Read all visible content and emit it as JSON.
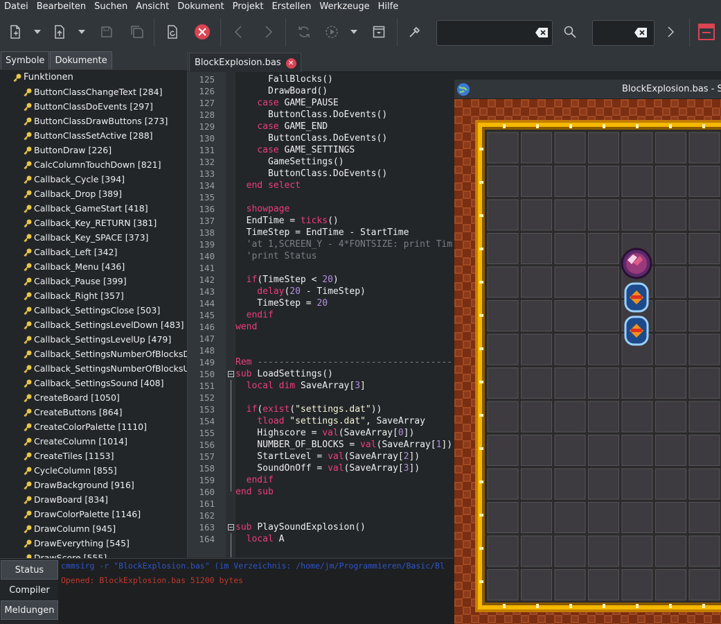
{
  "menu": [
    "Datei",
    "Bearbeiten",
    "Suchen",
    "Ansicht",
    "Dokument",
    "Projekt",
    "Erstellen",
    "Werkzeuge",
    "Hilfe"
  ],
  "toolbar": {
    "icons": [
      "new-file-icon",
      "open-file-icon",
      "save-icon",
      "save-all-icon",
      "reload-file-icon",
      "close-file-icon",
      "back-icon",
      "forward-icon",
      "compile-icon",
      "run-icon",
      "execute-icon",
      "color-chooser-icon",
      "search-icon",
      "jump-icon",
      "quit-icon"
    ],
    "search_value": "",
    "goto_value": ""
  },
  "left_panel": {
    "tabs": [
      "Symbole",
      "Dokumente"
    ],
    "active_tab": "Dokumente",
    "tree_root": "Funktionen",
    "items": [
      "ButtonClassChangeText [284]",
      "ButtonClassDoEvents [297]",
      "ButtonClassDrawButtons [273]",
      "ButtonClassSetActive [288]",
      "ButtonDraw [226]",
      "CalcColumnTouchDown [821]",
      "Callback_Cycle [394]",
      "Callback_Drop [389]",
      "Callback_GameStart [418]",
      "Callback_Key_RETURN [381]",
      "Callback_Key_SPACE [373]",
      "Callback_Left [342]",
      "Callback_Menu [436]",
      "Callback_Pause [399]",
      "Callback_Right [357]",
      "Callback_SettingsClose [503]",
      "Callback_SettingsLevelDown [483]",
      "Callback_SettingsLevelUp [479]",
      "Callback_SettingsNumberOfBlocksDo",
      "Callback_SettingsNumberOfBlocksUp",
      "Callback_SettingsSound [408]",
      "CreateBoard [1050]",
      "CreateButtons [864]",
      "CreateColorPalette [1110]",
      "CreateColumn [1014]",
      "CreateTiles [1153]",
      "CycleColumn [855]",
      "DrawBackground [916]",
      "DrawBoard [834]",
      "DrawColorPalette [1146]",
      "DrawColumn [945]",
      "DrawEverything [545]",
      "DrawScore [555]"
    ]
  },
  "editor": {
    "tab_label": "BlockExplosion.bas",
    "lines": [
      {
        "n": "125",
        "t": [
          [
            "pl",
            "      FallBlocks()"
          ]
        ]
      },
      {
        "n": "126",
        "t": [
          [
            "pl",
            "      DrawBoard()"
          ]
        ]
      },
      {
        "n": "127",
        "t": [
          [
            "kw",
            "    case "
          ],
          [
            "pl",
            "GAME_PAUSE"
          ]
        ]
      },
      {
        "n": "128",
        "t": [
          [
            "pl",
            "      ButtonClass.DoEvents()"
          ]
        ]
      },
      {
        "n": "129",
        "t": [
          [
            "kw",
            "    case "
          ],
          [
            "pl",
            "GAME_END"
          ]
        ]
      },
      {
        "n": "130",
        "t": [
          [
            "pl",
            "      ButtonClass.DoEvents()"
          ]
        ]
      },
      {
        "n": "131",
        "t": [
          [
            "kw",
            "    case "
          ],
          [
            "pl",
            "GAME_SETTINGS"
          ]
        ]
      },
      {
        "n": "132",
        "t": [
          [
            "pl",
            "      GameSettings()"
          ]
        ]
      },
      {
        "n": "133",
        "t": [
          [
            "pl",
            "      ButtonClass.DoEvents()"
          ]
        ]
      },
      {
        "n": "134",
        "t": [
          [
            "kw",
            "  end select"
          ]
        ]
      },
      {
        "n": "135",
        "t": []
      },
      {
        "n": "136",
        "t": [
          [
            "kw",
            "  showpage"
          ]
        ]
      },
      {
        "n": "137",
        "t": [
          [
            "pl",
            "  EndTime = "
          ],
          [
            "kw",
            "ticks"
          ],
          [
            "pl",
            "()"
          ]
        ]
      },
      {
        "n": "138",
        "t": [
          [
            "pl",
            "  TimeStep = EndTime - StartTime"
          ]
        ]
      },
      {
        "n": "139",
        "t": [
          [
            "cmt",
            "  'at 1,SCREEN_Y - 4*FONTSIZE: print Tim"
          ]
        ]
      },
      {
        "n": "140",
        "t": [
          [
            "cmt",
            "  'print Status"
          ]
        ]
      },
      {
        "n": "141",
        "t": []
      },
      {
        "n": "142",
        "t": [
          [
            "kw",
            "  if"
          ],
          [
            "pl",
            "(TimeStep < "
          ],
          [
            "num",
            "20"
          ],
          [
            "pl",
            ")"
          ]
        ]
      },
      {
        "n": "143",
        "t": [
          [
            "kw",
            "    delay"
          ],
          [
            "pl",
            "("
          ],
          [
            "num",
            "20"
          ],
          [
            "pl",
            " - TimeStep)"
          ]
        ]
      },
      {
        "n": "144",
        "t": [
          [
            "pl",
            "    TimeStep = "
          ],
          [
            "num",
            "20"
          ]
        ]
      },
      {
        "n": "145",
        "t": [
          [
            "kw",
            "  endif"
          ]
        ]
      },
      {
        "n": "146",
        "t": [
          [
            "kw",
            "wend"
          ]
        ]
      },
      {
        "n": "147",
        "t": []
      },
      {
        "n": "148",
        "t": []
      },
      {
        "n": "149",
        "t": [
          [
            "kw",
            "Rem "
          ],
          [
            "cmt",
            "-------------------------------------"
          ]
        ]
      },
      {
        "n": "150",
        "t": [
          [
            "kw",
            "sub "
          ],
          [
            "pl",
            "LoadSettings()"
          ]
        ]
      },
      {
        "n": "151",
        "t": [
          [
            "kw",
            "  local dim "
          ],
          [
            "pl",
            "SaveArray["
          ],
          [
            "num",
            "3"
          ],
          [
            "pl",
            "]"
          ]
        ]
      },
      {
        "n": "152",
        "t": []
      },
      {
        "n": "153",
        "t": [
          [
            "kw",
            "  if"
          ],
          [
            "pl",
            "("
          ],
          [
            "kw",
            "exist"
          ],
          [
            "pl",
            "("
          ],
          [
            "str",
            "\"settings.dat\""
          ],
          [
            "pl",
            "))"
          ]
        ]
      },
      {
        "n": "154",
        "t": [
          [
            "kw",
            "    tload "
          ],
          [
            "str",
            "\"settings.dat\""
          ],
          [
            "pl",
            ", SaveArray"
          ]
        ]
      },
      {
        "n": "155",
        "t": [
          [
            "pl",
            "    Highscore = "
          ],
          [
            "kw",
            "val"
          ],
          [
            "pl",
            "(SaveArray["
          ],
          [
            "num",
            "0"
          ],
          [
            "pl",
            "])"
          ]
        ]
      },
      {
        "n": "156",
        "t": [
          [
            "pl",
            "    NUMBER_OF_BLOCKS = "
          ],
          [
            "kw",
            "val"
          ],
          [
            "pl",
            "(SaveArray["
          ],
          [
            "num",
            "1"
          ],
          [
            "pl",
            "])"
          ]
        ]
      },
      {
        "n": "157",
        "t": [
          [
            "pl",
            "    StartLevel = "
          ],
          [
            "kw",
            "val"
          ],
          [
            "pl",
            "(SaveArray["
          ],
          [
            "num",
            "2"
          ],
          [
            "pl",
            "])"
          ]
        ]
      },
      {
        "n": "158",
        "t": [
          [
            "pl",
            "    SoundOnOff = "
          ],
          [
            "kw",
            "val"
          ],
          [
            "pl",
            "(SaveArray["
          ],
          [
            "num",
            "3"
          ],
          [
            "pl",
            "])"
          ]
        ]
      },
      {
        "n": "159",
        "t": [
          [
            "kw",
            "  endif"
          ]
        ]
      },
      {
        "n": "160",
        "t": [
          [
            "kw",
            "end sub"
          ]
        ]
      },
      {
        "n": "161",
        "t": []
      },
      {
        "n": "162",
        "t": []
      },
      {
        "n": "163",
        "t": [
          [
            "kw",
            "sub "
          ],
          [
            "pl",
            "PlaySoundExplosion()"
          ]
        ]
      },
      {
        "n": "164",
        "t": [
          [
            "kw",
            "  local "
          ],
          [
            "pl",
            "A"
          ]
        ]
      }
    ]
  },
  "game_window": {
    "title": "BlockExplosion.bas - Sm"
  },
  "bottom_panel": {
    "tabs": [
      "Status",
      "Compiler",
      "Meldungen"
    ],
    "active_tab": "Compiler",
    "messages": [
      {
        "text": "cmmsirg -r \"BlockExplosion.bas\" (im Verzeichnis: /home/jm/Programmieren/Basic/Bl",
        "color": "#2f55c9"
      },
      {
        "text": "Opened: BlockExplosion.bas 51200 bytes",
        "color": "#c0392b"
      }
    ]
  },
  "colors": {
    "accent_red": "#da4453",
    "keyword": "#ef3d7a",
    "number": "#b08fe0",
    "board_frame": "#f5b800",
    "board_bg": "#8b3a1a"
  }
}
